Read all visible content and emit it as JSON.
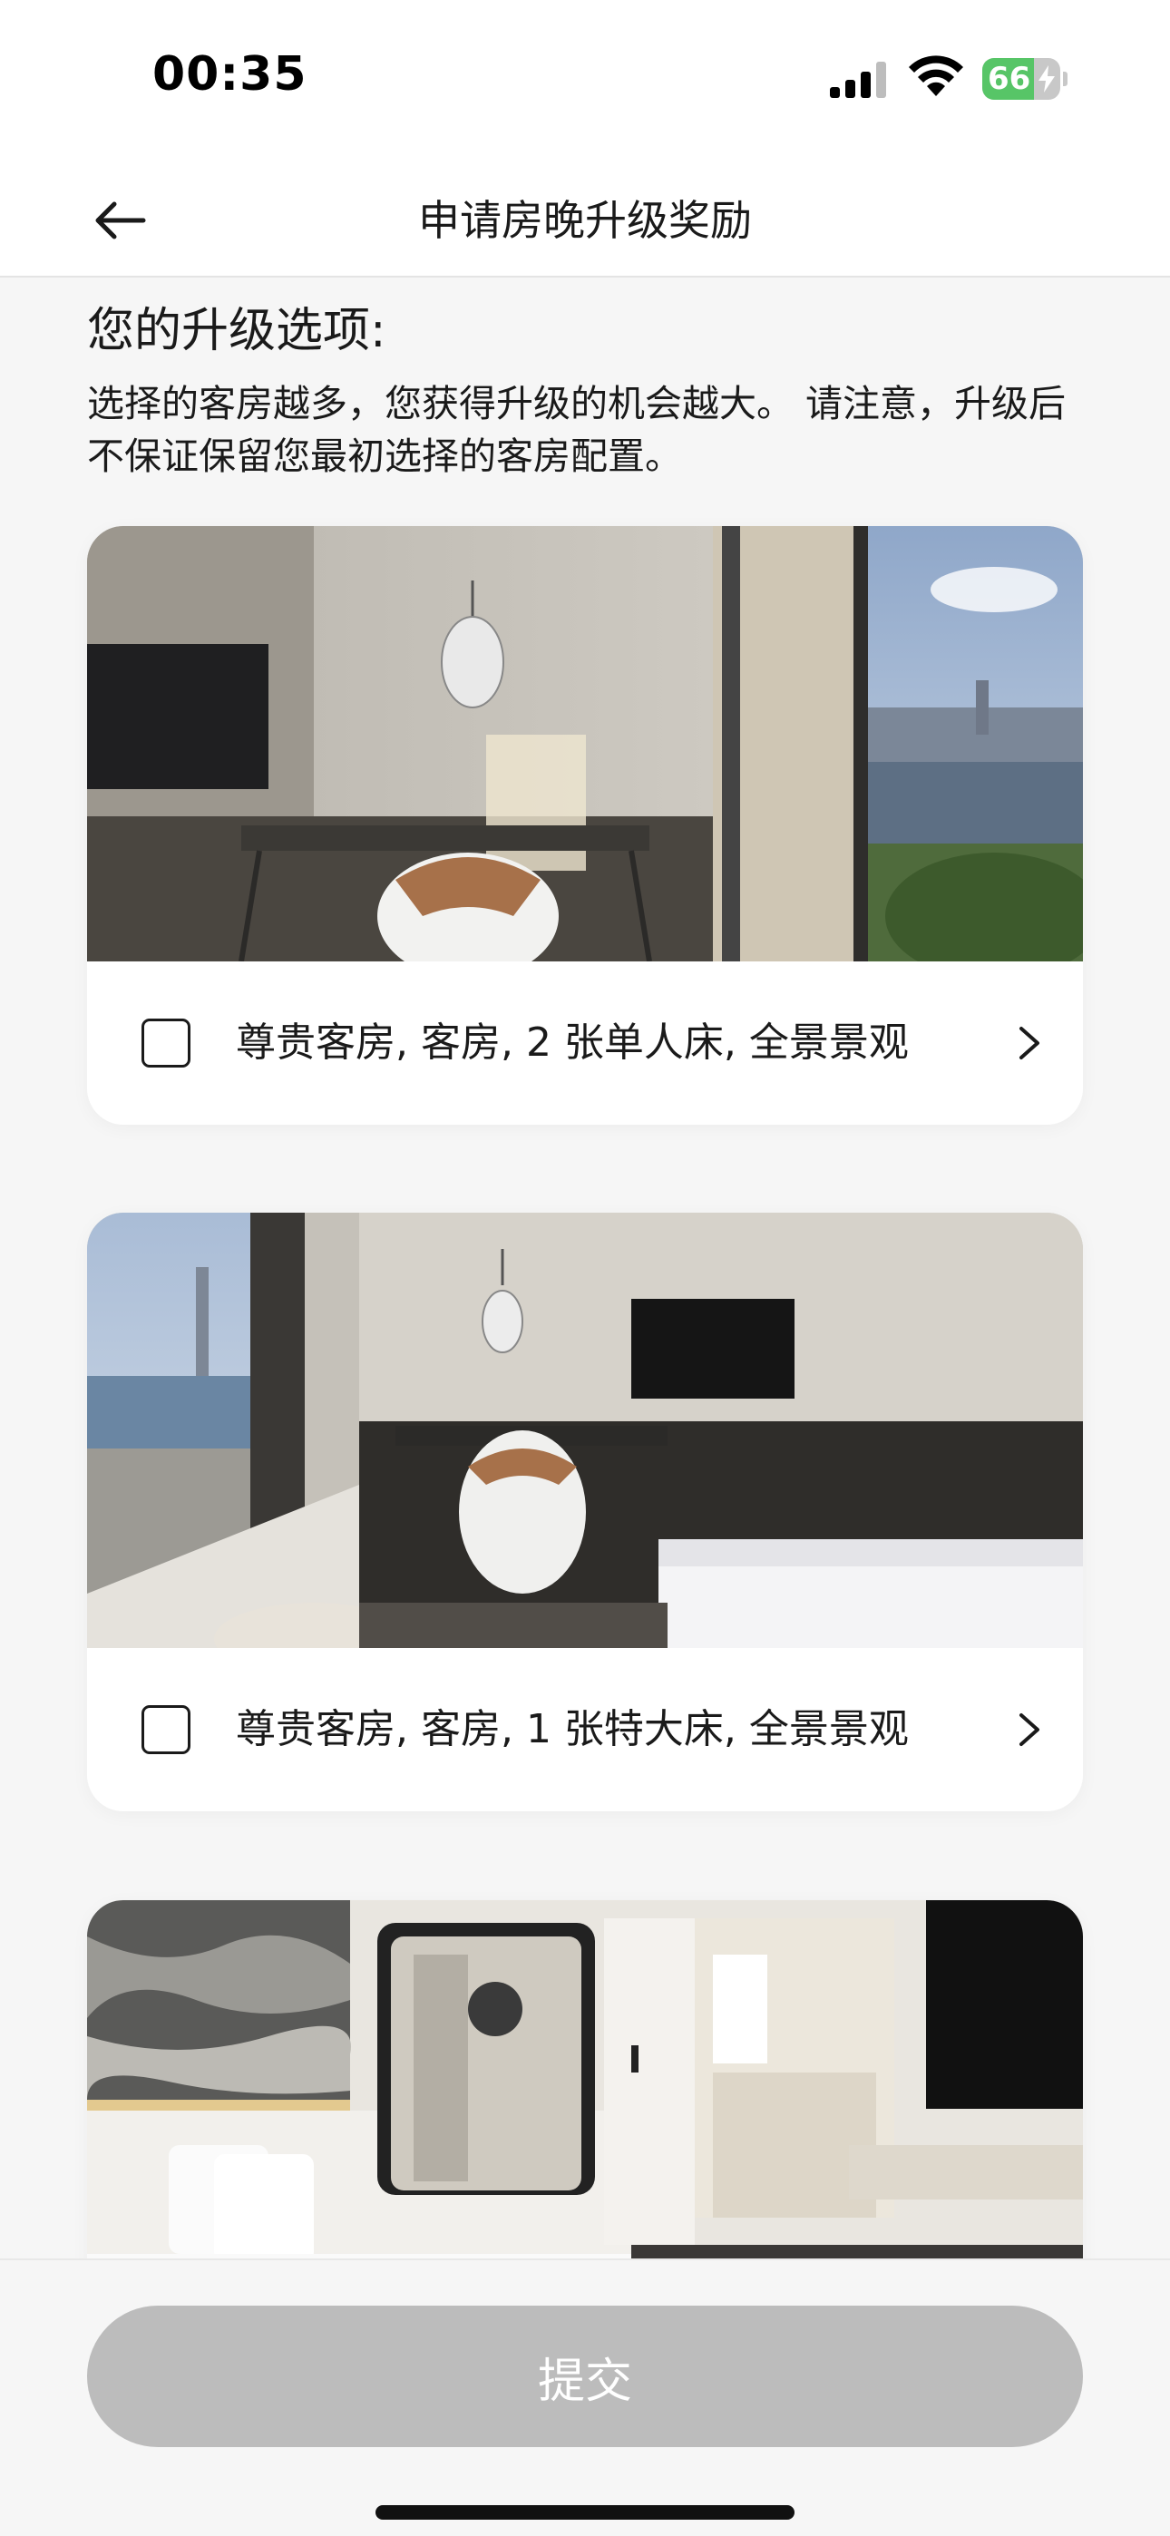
{
  "status_bar": {
    "time": "00:35",
    "battery_level": "66",
    "battery_fraction": 0.66,
    "icons": [
      "signal-icon",
      "wifi-icon",
      "battery-icon",
      "bolt-icon"
    ]
  },
  "header": {
    "back_icon": "arrow-left-icon",
    "title": "申请房晚升级奖励"
  },
  "intro": {
    "title": "您的升级选项:",
    "description": "选择的客房越多，您获得升级的机会越大。 请注意，升级后不保证保留您最初选择的客房配置。"
  },
  "rooms": [
    {
      "label": "尊贵客房, 客房, 2 张单人床, 全景景观",
      "checked": false,
      "icon": "chevron-right-icon"
    },
    {
      "label": "尊贵客房, 客房, 1 张特大床, 全景景观",
      "checked": false,
      "icon": "chevron-right-icon"
    },
    {
      "label": "",
      "checked": false,
      "icon": "chevron-right-icon"
    }
  ],
  "footer": {
    "submit_label": "提交",
    "submit_enabled": false
  },
  "colors": {
    "battery_green": "#57c567",
    "submit_disabled": "#bcbcbc",
    "page_background": "#f6f6f6"
  }
}
